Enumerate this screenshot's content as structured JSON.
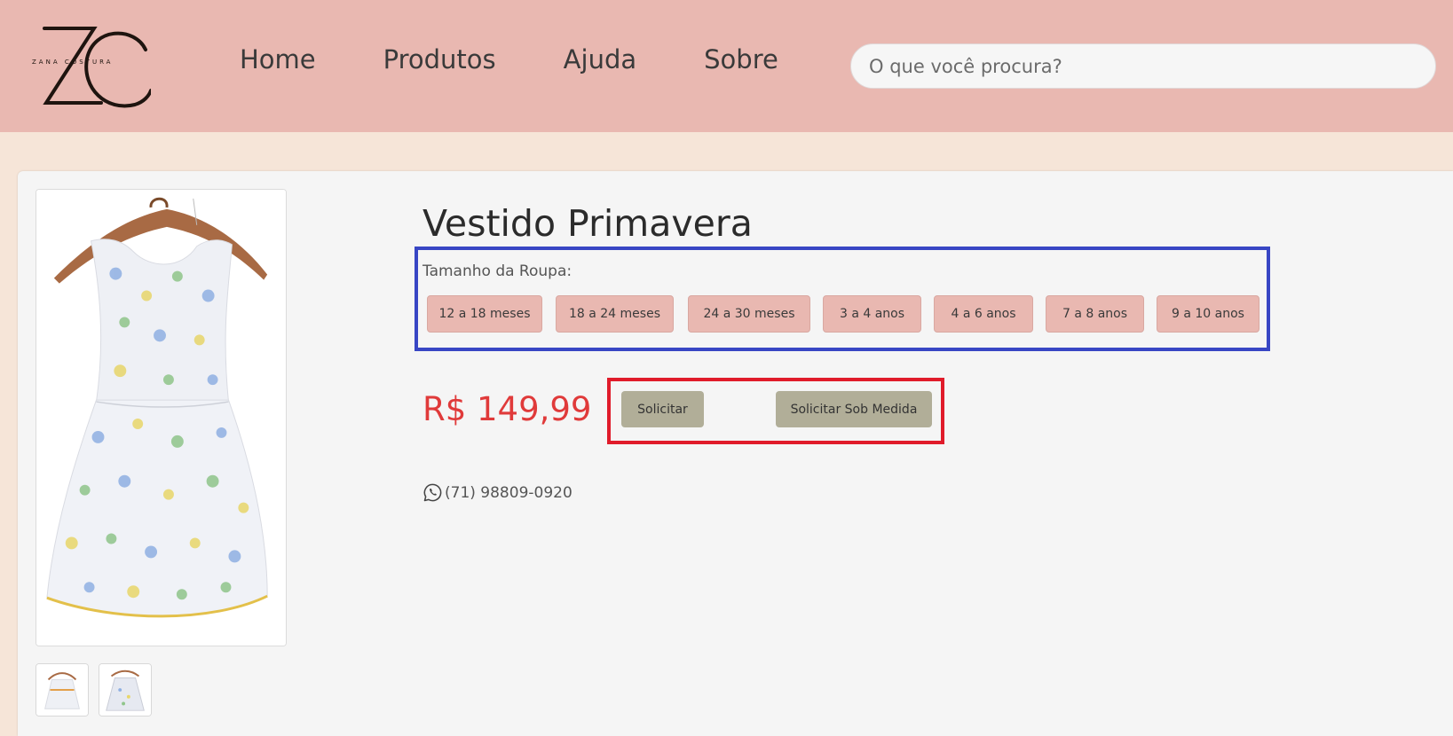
{
  "header": {
    "logo_text": "ZANA COSTURA",
    "nav": [
      "Home",
      "Produtos",
      "Ajuda",
      "Sobre"
    ],
    "search_placeholder": "O que você procura?"
  },
  "product": {
    "title": "Vestido Primavera",
    "size_label": "Tamanho da Roupa:",
    "sizes": [
      "12 a 18 meses",
      "18 a 24 meses",
      "24 a 30 meses",
      "3 a 4 anos",
      "4 a 6 anos",
      "7 a 8 anos",
      "9 a 10 anos"
    ],
    "price": "R$ 149,99",
    "actions": {
      "request": "Solicitar",
      "custom_request": "Solicitar Sob Medida"
    },
    "phone": "(71) 98809-0920"
  },
  "colors": {
    "header_bg": "#e9b8b1",
    "page_bg": "#f6e5d8",
    "card_bg": "#f5f5f5",
    "price": "#e03a3a",
    "size_button": "#e9b8b1",
    "action_button": "#b1ae98",
    "highlight_sizes": "#3846c4",
    "highlight_actions": "#e01b2a"
  },
  "icons": {
    "phone": "whatsapp-icon"
  }
}
